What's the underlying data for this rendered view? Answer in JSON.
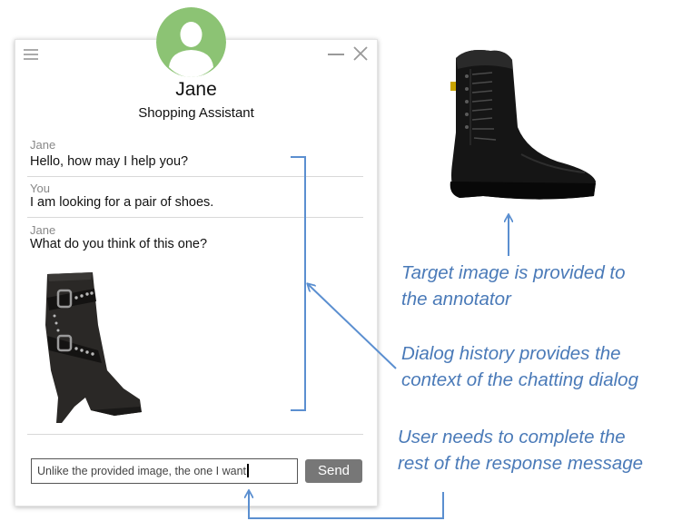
{
  "window": {
    "menu_icon": "hamburger-menu-icon",
    "minimize_icon": "minimize-icon",
    "close_icon": "close-icon"
  },
  "agent": {
    "name": "Jane",
    "role": "Shopping Assistant",
    "avatar_icon": "user-avatar-icon",
    "avatar_color": "#8cc374"
  },
  "messages": [
    {
      "sender": "Jane",
      "text": "Hello, how may I help you?"
    },
    {
      "sender": "You",
      "text": "I am looking for a pair of shoes."
    },
    {
      "sender": "Jane",
      "text": "What do you think of this one?"
    }
  ],
  "composer": {
    "input_value": "Unlike the provided image, the one I want",
    "send_label": "Send"
  },
  "annotations": {
    "target": [
      "Target image is provided to",
      "the annotator"
    ],
    "history": [
      "Dialog history provides the",
      "context of the chatting dialog"
    ],
    "user": [
      "User needs to complete the",
      "rest of the response message"
    ]
  },
  "colors": {
    "annotation": "#4a7ab8",
    "send_button": "#777777"
  }
}
